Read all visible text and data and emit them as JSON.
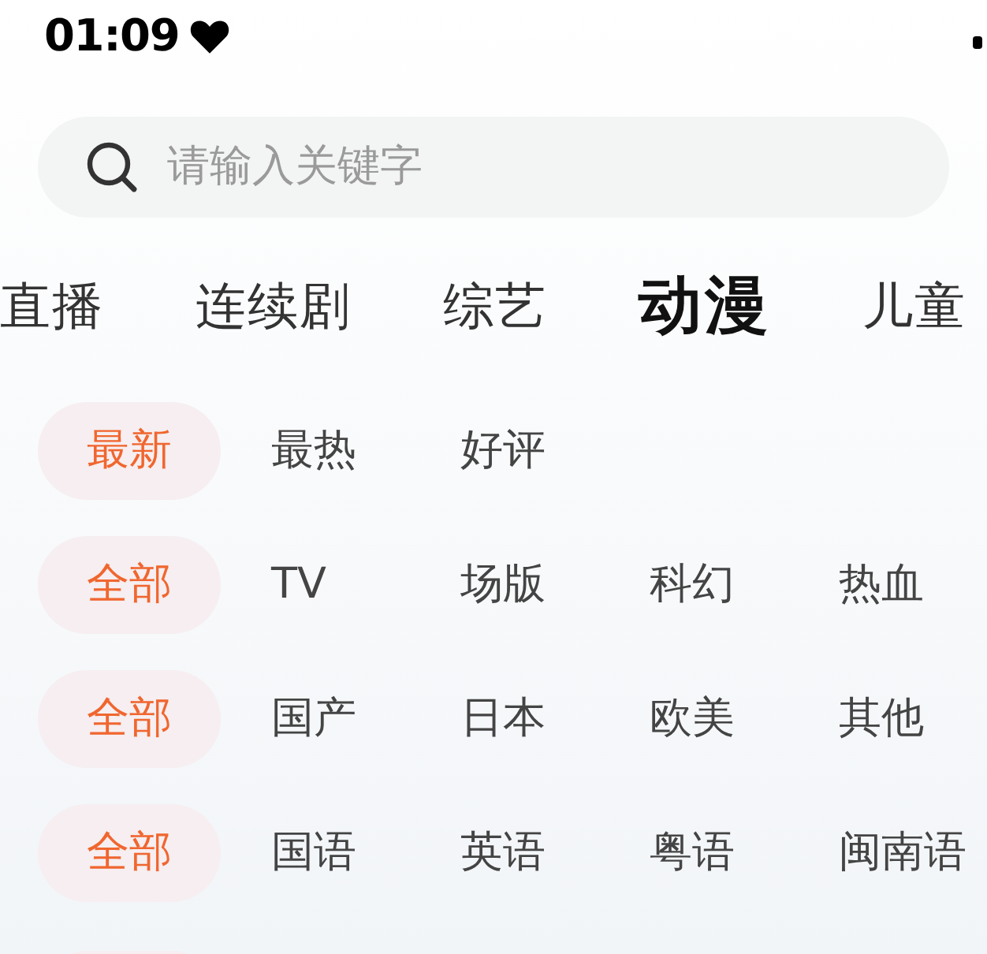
{
  "status_bar": {
    "time": "01:09"
  },
  "search": {
    "placeholder": "请输入关键字"
  },
  "categories": [
    {
      "label": "直播",
      "selected": false
    },
    {
      "label": "连续剧",
      "selected": false
    },
    {
      "label": "综艺",
      "selected": false
    },
    {
      "label": "动漫",
      "selected": true
    },
    {
      "label": "儿童",
      "selected": false
    }
  ],
  "filters": [
    {
      "options": [
        {
          "label": "最新",
          "selected": true
        },
        {
          "label": "最热",
          "selected": false
        },
        {
          "label": "好评",
          "selected": false
        }
      ]
    },
    {
      "options": [
        {
          "label": "全部",
          "selected": true
        },
        {
          "label": "TV",
          "selected": false
        },
        {
          "label": "场版",
          "selected": false
        },
        {
          "label": "科幻",
          "selected": false
        },
        {
          "label": "热血",
          "selected": false
        }
      ]
    },
    {
      "options": [
        {
          "label": "全部",
          "selected": true
        },
        {
          "label": "国产",
          "selected": false
        },
        {
          "label": "日本",
          "selected": false
        },
        {
          "label": "欧美",
          "selected": false
        },
        {
          "label": "其他",
          "selected": false
        }
      ]
    },
    {
      "options": [
        {
          "label": "全部",
          "selected": true
        },
        {
          "label": "国语",
          "selected": false
        },
        {
          "label": "英语",
          "selected": false
        },
        {
          "label": "粤语",
          "selected": false
        },
        {
          "label": "闽南语",
          "selected": false
        }
      ]
    }
  ]
}
